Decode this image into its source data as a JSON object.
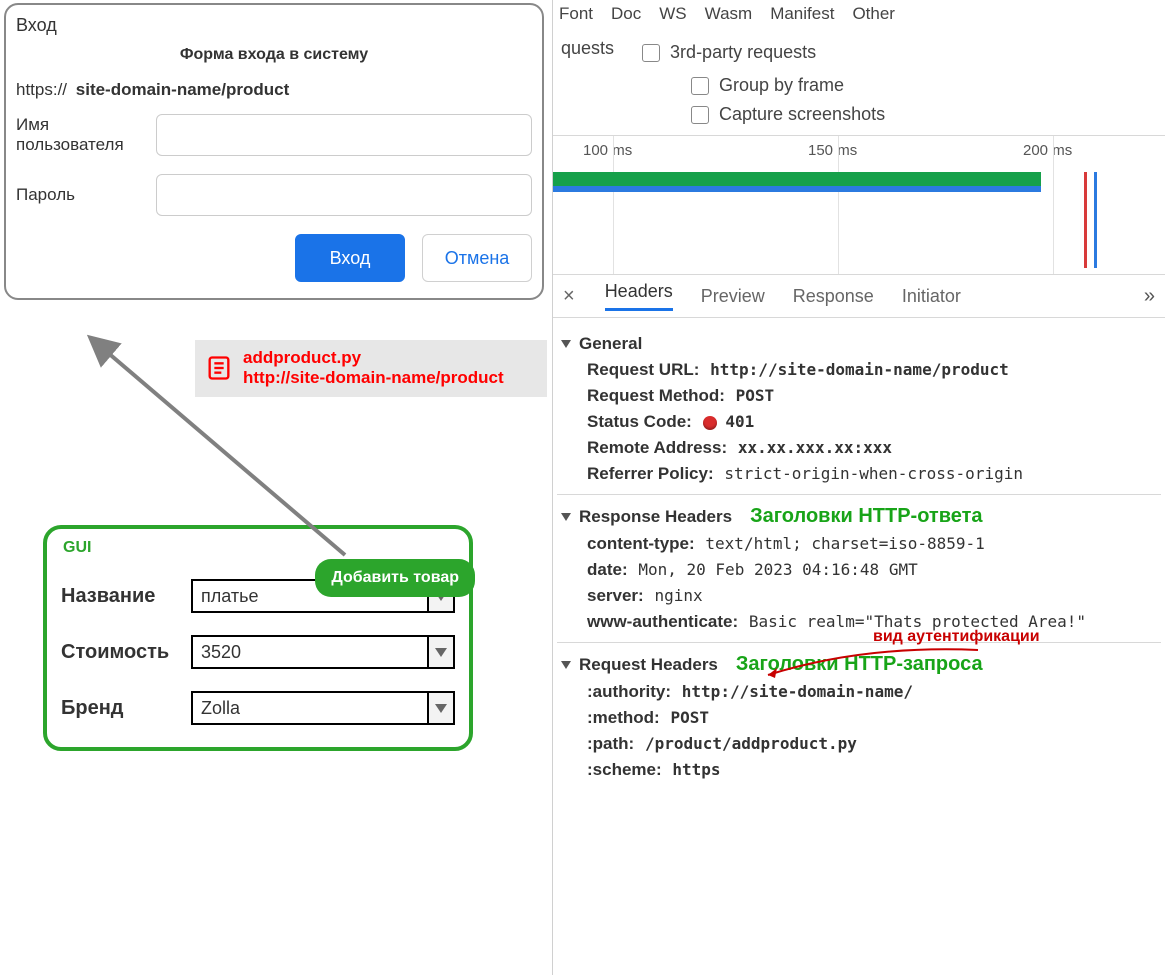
{
  "login": {
    "title": "Вход",
    "subtitle": "Форма входа в систему",
    "url_scheme": "https://",
    "url_host": "site-domain-name/product",
    "username_label": "Имя пользователя",
    "password_label": "Пароль",
    "btn_ok": "Вход",
    "btn_cancel": "Отмена"
  },
  "file": {
    "name": "addproduct.py",
    "url": "http://site-domain-name/product"
  },
  "gui": {
    "title": "GUI",
    "add_btn": "Добавить товар",
    "rows": {
      "name_label": "Название",
      "name_value": "платье",
      "price_label": "Стоимость",
      "price_value": "3520",
      "brand_label": "Бренд",
      "brand_value": "Zolla"
    }
  },
  "devtools": {
    "filter_tabs": [
      "Font",
      "Doc",
      "WS",
      "Wasm",
      "Manifest",
      "Other"
    ],
    "checkboxes": {
      "quests": "quests",
      "third_party": "3rd-party requests",
      "group_by_frame": "Group by frame",
      "capture_ss": "Capture screenshots"
    },
    "timeline_ticks": [
      "100 ms",
      "150 ms",
      "200 ms"
    ],
    "sec_tabs": [
      "Headers",
      "Preview",
      "Response",
      "Initiator"
    ],
    "more_glyph": "»",
    "close_glyph": "×",
    "general": {
      "title": "General",
      "request_url_k": "Request URL:",
      "request_url_v": "http://site-domain-name/product",
      "request_method_k": "Request Method:",
      "request_method_v": "POST",
      "status_code_k": "Status Code:",
      "status_code_v": "401",
      "remote_addr_k": "Remote Address:",
      "remote_addr_v": "xx.xx.xxx.xx:xxx",
      "referrer_k": "Referrer Policy:",
      "referrer_v": "strict-origin-when-cross-origin"
    },
    "response_headers": {
      "title": "Response Headers",
      "note": "Заголовки HTTP-ответа",
      "content_type_k": "content-type:",
      "content_type_v": "text/html; charset=iso-8859-1",
      "date_k": "date:",
      "date_v": "Mon, 20 Feb 2023 04:16:48 GMT",
      "server_k": "server:",
      "server_v": "nginx",
      "www_auth_k": "www-authenticate:",
      "www_auth_v": "Basic realm=\"Thats protected Area!\"",
      "annotation": "вид аутентификации"
    },
    "request_headers": {
      "title": "Request Headers",
      "note": "Заголовки HTTP-запроса",
      "authority_k": ":authority:",
      "authority_v": "http://site-domain-name/",
      "method_k": ":method:",
      "method_v": "POST",
      "path_k": ":path:",
      "path_v": "/product/addproduct.py",
      "scheme_k": ":scheme:",
      "scheme_v": "https"
    }
  }
}
